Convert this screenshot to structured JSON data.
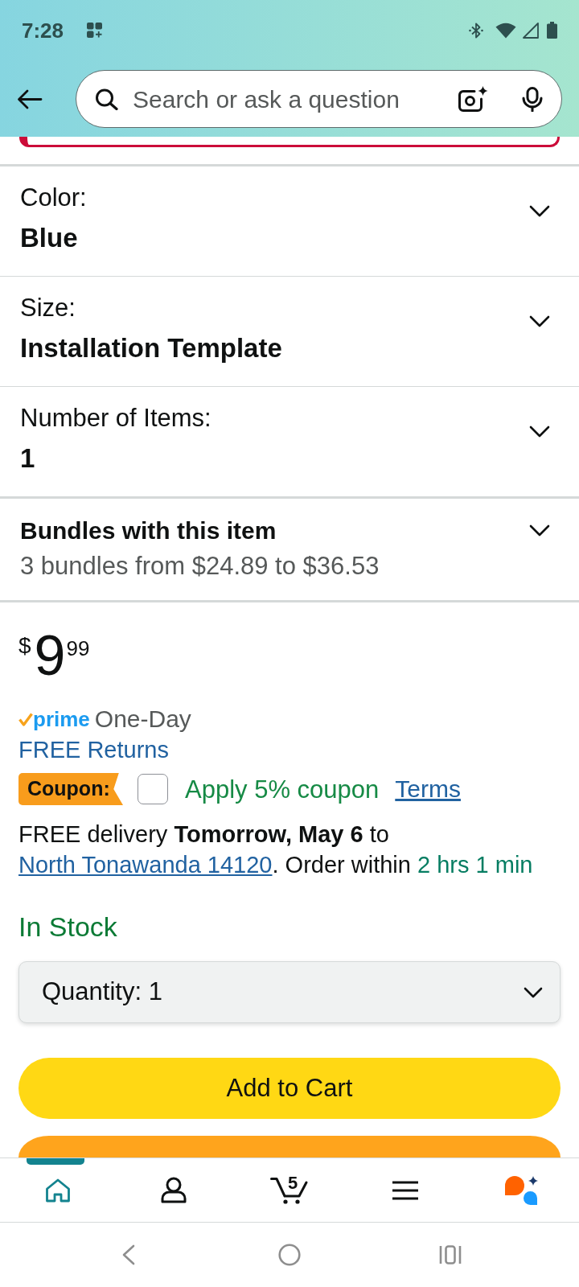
{
  "status_bar": {
    "time": "7:28"
  },
  "search": {
    "placeholder": "Search or ask a question"
  },
  "options": [
    {
      "label": "Color:",
      "value": "Blue",
      "expanded": false
    },
    {
      "label": "Size:",
      "value": "Installation Template",
      "expanded": false
    },
    {
      "label": "Number of Items:",
      "value": "1",
      "expanded": false
    }
  ],
  "bundles": {
    "title": "Bundles with this item",
    "summary": "3 bundles from $24.89 to $36.53",
    "expanded": false
  },
  "price": {
    "currency": "$",
    "whole": "9",
    "fraction": "99"
  },
  "prime": {
    "logo": "prime",
    "speed": "One-Day"
  },
  "returns": "FREE Returns",
  "coupon": {
    "badge": "Coupon:",
    "checked": false,
    "label": "Apply 5% coupon",
    "terms": "Terms"
  },
  "delivery": {
    "text": "FREE delivery **Tomorrow, May 6** to",
    "location": "North Tonawanda 14120",
    "after_location": ". Order within",
    "countdown": "2 hrs 1 min"
  },
  "stock": "In Stock",
  "quantity": {
    "label": "Quantity:",
    "value": "1"
  },
  "add_to_cart": "Add to Cart",
  "bottom_nav": [
    {
      "kind": "home",
      "selected": true
    },
    {
      "kind": "account",
      "selected": false
    },
    {
      "kind": "cart",
      "selected": false,
      "badge": "5"
    },
    {
      "kind": "menu",
      "selected": false
    },
    {
      "kind": "assistant",
      "selected": false
    }
  ]
}
